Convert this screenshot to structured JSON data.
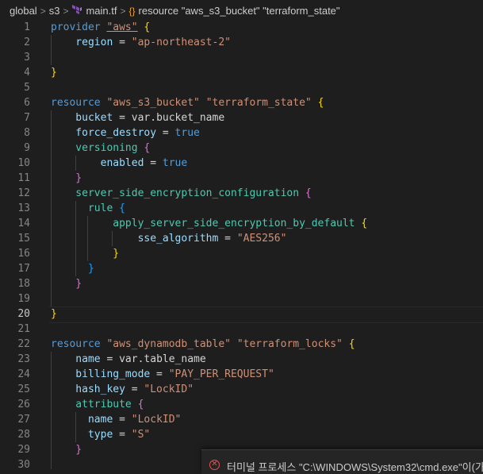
{
  "breadcrumb": {
    "items": [
      "global",
      "s3",
      "main.tf",
      "resource \"aws_s3_bucket\" \"terraform_state\""
    ]
  },
  "editor": {
    "active_line": 20,
    "line_numbers": [
      "1",
      "2",
      "3",
      "4",
      "5",
      "6",
      "7",
      "8",
      "9",
      "10",
      "11",
      "12",
      "13",
      "14",
      "15",
      "16",
      "17",
      "18",
      "19",
      "20",
      "21",
      "22",
      "23",
      "24",
      "25",
      "26",
      "27",
      "28",
      "29",
      "30"
    ],
    "lines": [
      [
        [
          "k",
          "provider "
        ],
        [
          "s u",
          "\"aws\""
        ],
        [
          "o",
          " "
        ],
        [
          "b1",
          "{"
        ]
      ],
      [
        [
          "a",
          "    region"
        ],
        [
          "o",
          " = "
        ],
        [
          "s",
          "\"ap-northeast-2\""
        ]
      ],
      [],
      [
        [
          "b1",
          "}"
        ]
      ],
      [],
      [
        [
          "k",
          "resource "
        ],
        [
          "s",
          "\"aws_s3_bucket\""
        ],
        [
          "o",
          " "
        ],
        [
          "s",
          "\"terraform_state\""
        ],
        [
          "o",
          " "
        ],
        [
          "b1",
          "{"
        ]
      ],
      [
        [
          "a",
          "    bucket"
        ],
        [
          "o",
          " = var.bucket_name"
        ]
      ],
      [
        [
          "a",
          "    force_destroy"
        ],
        [
          "o",
          " = "
        ],
        [
          "t",
          "true"
        ]
      ],
      [
        [
          "f",
          "    versioning"
        ],
        [
          "o",
          " "
        ],
        [
          "b2",
          "{"
        ]
      ],
      [
        [
          "a",
          "        enabled"
        ],
        [
          "o",
          " = "
        ],
        [
          "t",
          "true"
        ]
      ],
      [
        [
          "b2",
          "    }"
        ]
      ],
      [
        [
          "f",
          "    server_side_encryption_configuration"
        ],
        [
          "o",
          " "
        ],
        [
          "b2",
          "{"
        ]
      ],
      [
        [
          "f",
          "      rule"
        ],
        [
          "o",
          " "
        ],
        [
          "b3",
          "{"
        ]
      ],
      [
        [
          "f",
          "          apply_server_side_encryption_by_default"
        ],
        [
          "o",
          " "
        ],
        [
          "b1",
          "{"
        ]
      ],
      [
        [
          "a",
          "              sse_algorithm"
        ],
        [
          "o",
          " = "
        ],
        [
          "s",
          "\"AES256\""
        ]
      ],
      [
        [
          "b1",
          "          }"
        ]
      ],
      [
        [
          "b3",
          "      }"
        ]
      ],
      [
        [
          "b2",
          "    }"
        ]
      ],
      [],
      [
        [
          "b1",
          "}"
        ]
      ],
      [],
      [
        [
          "k",
          "resource "
        ],
        [
          "s",
          "\"aws_dynamodb_table\""
        ],
        [
          "o",
          " "
        ],
        [
          "s",
          "\"terraform_locks\""
        ],
        [
          "o",
          " "
        ],
        [
          "b1",
          "{"
        ]
      ],
      [
        [
          "a",
          "    name"
        ],
        [
          "o",
          " = var.table_name"
        ]
      ],
      [
        [
          "a",
          "    billing_mode"
        ],
        [
          "o",
          " = "
        ],
        [
          "s",
          "\"PAY_PER_REQUEST\""
        ]
      ],
      [
        [
          "a",
          "    hash_key"
        ],
        [
          "o",
          " = "
        ],
        [
          "s",
          "\"LockID\""
        ]
      ],
      [
        [
          "f",
          "    attribute"
        ],
        [
          "o",
          " "
        ],
        [
          "b2",
          "{"
        ]
      ],
      [
        [
          "a",
          "      name"
        ],
        [
          "o",
          " = "
        ],
        [
          "s",
          "\"LockID\""
        ]
      ],
      [
        [
          "a",
          "      type"
        ],
        [
          "o",
          " = "
        ],
        [
          "s",
          "\"S\""
        ]
      ],
      [
        [
          "b2",
          "    }"
        ]
      ],
      []
    ]
  },
  "notification": {
    "icon": "error-icon",
    "text": "터미널 프로세스 \"C:\\WINDOWS\\System32\\cmd.exe\"이(가"
  },
  "colors": {
    "background": "#1e1e1e",
    "keyword": "#569cd6",
    "string": "#ce9178",
    "attribute": "#9cdcfe",
    "block": "#4ec9b0"
  }
}
